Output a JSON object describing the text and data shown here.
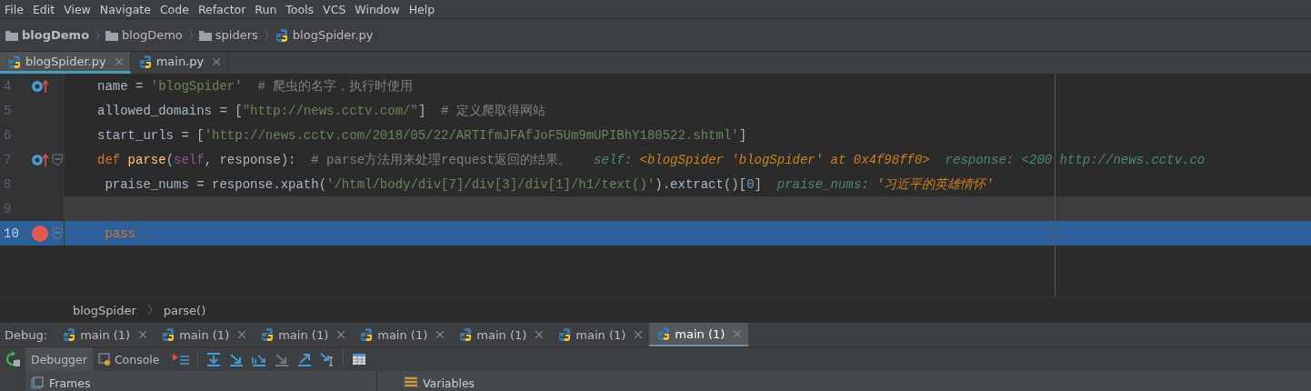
{
  "menu": [
    "File",
    "Edit",
    "View",
    "Navigate",
    "Code",
    "Refactor",
    "Run",
    "Tools",
    "VCS",
    "Window",
    "Help"
  ],
  "breadcrumbs": [
    {
      "label": "blogDemo",
      "kind": "project"
    },
    {
      "label": "blogDemo",
      "kind": "folder"
    },
    {
      "label": "spiders",
      "kind": "folder"
    },
    {
      "label": "blogSpider.py",
      "kind": "python"
    }
  ],
  "editor_tabs": [
    {
      "label": "blogSpider.py",
      "selected": true
    },
    {
      "label": "main.py",
      "selected": false
    }
  ],
  "code_lines": [
    {
      "number": "4",
      "override": true,
      "breakpoint": false,
      "fold": false,
      "caret": false,
      "execution": false,
      "segments": [
        {
          "kind": "plain",
          "text": "name = "
        },
        {
          "kind": "string",
          "text": "'blogSpider'"
        },
        {
          "kind": "comment",
          "text": "  # 爬虫的名字，执行时使用"
        }
      ]
    },
    {
      "number": "5",
      "override": false,
      "breakpoint": false,
      "fold": false,
      "caret": false,
      "execution": false,
      "segments": [
        {
          "kind": "plain",
          "text": "allowed_domains = ["
        },
        {
          "kind": "string",
          "text": "\"http://news.cctv.com/\""
        },
        {
          "kind": "plain",
          "text": "]"
        },
        {
          "kind": "comment",
          "text": "  # 定义爬取得网站"
        }
      ]
    },
    {
      "number": "6",
      "override": false,
      "breakpoint": false,
      "fold": false,
      "caret": false,
      "execution": false,
      "segments": [
        {
          "kind": "plain",
          "text": "start_urls = ["
        },
        {
          "kind": "string",
          "text": "'http://news.cctv.com/2018/05/22/ARTIfmJFAfJoF5Um9mUPIBhY180522.shtml'"
        },
        {
          "kind": "plain",
          "text": "]"
        }
      ]
    },
    {
      "number": "7",
      "override": true,
      "breakpoint": false,
      "fold": true,
      "caret": false,
      "execution": false,
      "segments": [
        {
          "kind": "keyword",
          "text": "def "
        },
        {
          "kind": "function",
          "text": "parse"
        },
        {
          "kind": "plain",
          "text": "("
        },
        {
          "kind": "self",
          "text": "self"
        },
        {
          "kind": "plain",
          "text": ", response):"
        },
        {
          "kind": "comment",
          "text": "  # parse方法用来处理request返回的结果。"
        },
        {
          "kind": "hint-label",
          "text": "   self: "
        },
        {
          "kind": "hint-value",
          "text": "<blogSpider 'blogSpider' at 0x4f98ff0>"
        },
        {
          "kind": "hint-label",
          "text": "  response: <200 http://news.cctv.co"
        }
      ]
    },
    {
      "number": "8",
      "override": false,
      "breakpoint": false,
      "fold": false,
      "caret": false,
      "execution": false,
      "segments": [
        {
          "kind": "plain",
          "text": " praise_nums = response.xpath("
        },
        {
          "kind": "string",
          "text": "'/html/body/div[7]/div[3]/div[1]/h1/text()'"
        },
        {
          "kind": "plain",
          "text": ").extract()["
        },
        {
          "kind": "number",
          "text": "0"
        },
        {
          "kind": "plain",
          "text": "]"
        },
        {
          "kind": "hint-label",
          "text": "  praise_nums: "
        },
        {
          "kind": "hint-value",
          "text": "'习近平的英雄情怀'"
        }
      ]
    },
    {
      "number": "9",
      "override": false,
      "breakpoint": false,
      "fold": false,
      "caret": true,
      "execution": false
    },
    {
      "number": "10",
      "override": false,
      "breakpoint": true,
      "fold": true,
      "caret": false,
      "execution": true,
      "segments": [
        {
          "kind": "keyword",
          "text": " pass"
        }
      ]
    }
  ],
  "code_breadcrumbs": [
    "blogSpider",
    "parse()"
  ],
  "debug": {
    "label": "Debug:",
    "tabs": [
      {
        "label": "main (1)",
        "selected": false
      },
      {
        "label": "main (1)",
        "selected": false
      },
      {
        "label": "main (1)",
        "selected": false
      },
      {
        "label": "main (1)",
        "selected": false
      },
      {
        "label": "main (1)",
        "selected": false
      },
      {
        "label": "main (1)",
        "selected": false
      },
      {
        "label": "main (1)",
        "selected": true
      }
    ],
    "subtabs": [
      {
        "label": "Debugger",
        "selected": true
      },
      {
        "label": "Console",
        "selected": false
      }
    ],
    "frames_title": "Frames",
    "variables_title": "Variables"
  }
}
